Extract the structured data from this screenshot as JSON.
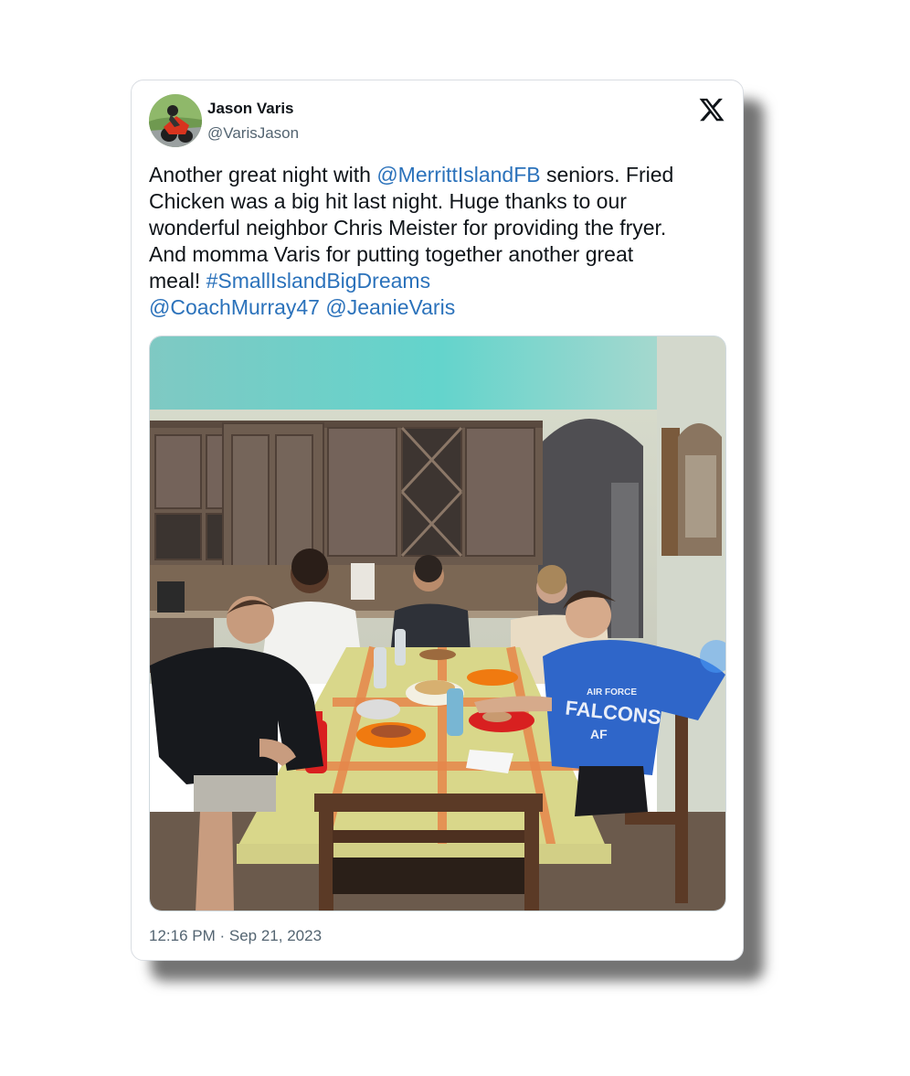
{
  "tweet": {
    "author": {
      "display_name": "Jason Varis",
      "handle": "@VarisJason"
    },
    "platform_icon": "x-logo-icon",
    "text_segments": [
      {
        "text": "Another great night with ",
        "link": false
      },
      {
        "text": "@MerrittIslandFB",
        "link": true
      },
      {
        "text": " seniors.  Fried\nChicken was a big hit last night.  Huge thanks to our\nwonderful neighbor Chris Meister for providing the fryer.\nAnd momma Varis for putting together another great\nmeal! ",
        "link": false
      },
      {
        "text": "#SmallIslandBigDreams",
        "link": true
      },
      {
        "text": "\n",
        "link": false
      },
      {
        "text": "@CoachMurray47",
        "link": true
      },
      {
        "text": " ",
        "link": false
      },
      {
        "text": "@JeanieVaris",
        "link": true
      }
    ],
    "media": {
      "printed_text": {
        "shirt_line1": "AIR FORCE",
        "shirt_line2": "FALCONS",
        "shirt_logo": "AF"
      }
    },
    "timestamp": "12:16 PM · Sep 21, 2023"
  },
  "colors": {
    "link": "#2b72bb",
    "text": "#0f1419",
    "secondary": "#536471",
    "card_border": "#d9dde2"
  }
}
